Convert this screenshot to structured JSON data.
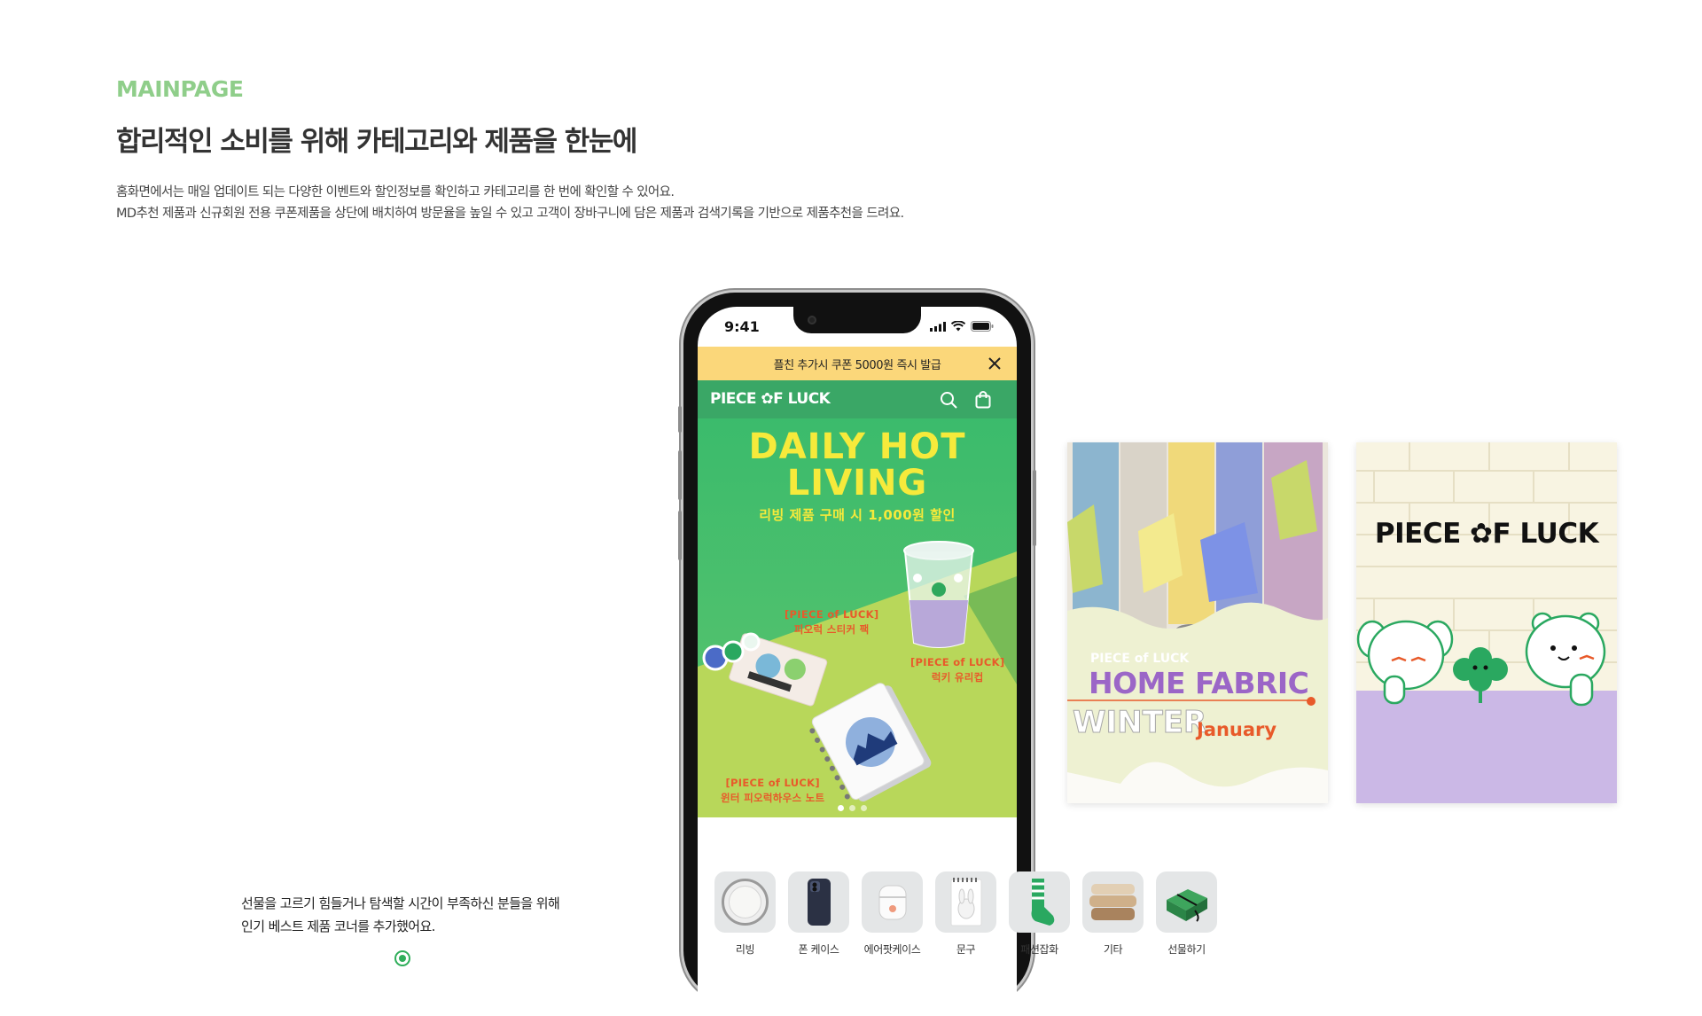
{
  "section": {
    "eyebrow": "MAINPAGE",
    "headline": "합리적인 소비를 위해 카테고리와 제품을 한눈에",
    "description": [
      "홈화면에서는 매일 업데이트 되는 다양한 이벤트와 할인정보를 확인하고 카테고리를 한 번에 확인할 수 있어요.",
      "MD추천 제품과 신규회원 전용 쿠폰제품을 상단에 배치하여 방문율을 높일 수 있고 고객이 장바구니에 담은 제품과 검색기록을 기반으로 제품추천을 드려요."
    ]
  },
  "phone": {
    "status_time": "9:41",
    "promo_text": "플친 추가시 쿠폰 5000원 즉시 발급",
    "logo": "PIECE ✿F LUCK",
    "banner": {
      "title_line1": "DAILY HOT",
      "title_line2": "LIVING",
      "subtitle": "리빙 제품 구매 시 1,000원 할인",
      "products": [
        {
          "brand": "[PIECE of LUCK]",
          "name": "피오럭 스티커 팩"
        },
        {
          "brand": "[PIECE of LUCK]",
          "name": "럭키 유리컵"
        },
        {
          "brand": "[PIECE of LUCK]",
          "name": "윈터 피오럭하우스 노트"
        }
      ],
      "slide_count": 3,
      "active_slide": 1
    },
    "categories": [
      {
        "label": "리빙",
        "icon": "plate-icon"
      },
      {
        "label": "폰 케이스",
        "icon": "phone-case-icon"
      },
      {
        "label": "에어팟케이스",
        "icon": "airpods-case-icon"
      },
      {
        "label": "문구",
        "icon": "notebook-icon"
      },
      {
        "label": "패션잡화",
        "icon": "sock-icon"
      },
      {
        "label": "기타",
        "icon": "cushion-icon"
      },
      {
        "label": "선물하기",
        "icon": "gift-box-icon"
      }
    ]
  },
  "cards": {
    "fabric": {
      "brand": "PIECE of LUCK",
      "title": "HOME FABRIC",
      "season": "WINTER",
      "month": "January"
    },
    "brand_card": {
      "logo": "PIECE ✿F LUCK"
    }
  },
  "note": {
    "line1": "선물을 고르기 힘들거나 탐색할 시간이 부족하신 분들을 위해",
    "line2": "인기 베스트 제품 코너를 추가했어요."
  },
  "colors": {
    "accent_green": "#3aa766",
    "eyebrow_green": "#8fce8a",
    "promo_yellow": "#fbd77a",
    "banner_yellow": "#f6ea3b",
    "label_orange": "#e85a2a",
    "fabric_purple": "#9b66c7"
  }
}
